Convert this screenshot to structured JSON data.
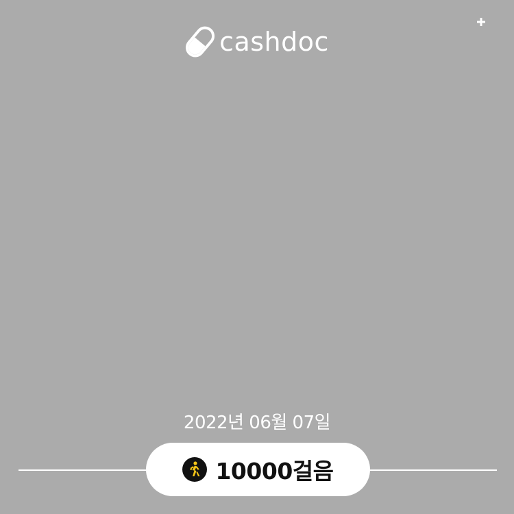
{
  "brand": {
    "wordmark": "cashdoc",
    "icon": "pill-icon"
  },
  "date": {
    "text": "2022년 06월 07일"
  },
  "steps": {
    "icon": "walking-person-icon",
    "count": "10000",
    "unit": "걸음"
  },
  "colors": {
    "background": "#ababab",
    "pill_background": "#ffffff",
    "text_dark": "#111111",
    "walk_icon": "#f5c518"
  }
}
